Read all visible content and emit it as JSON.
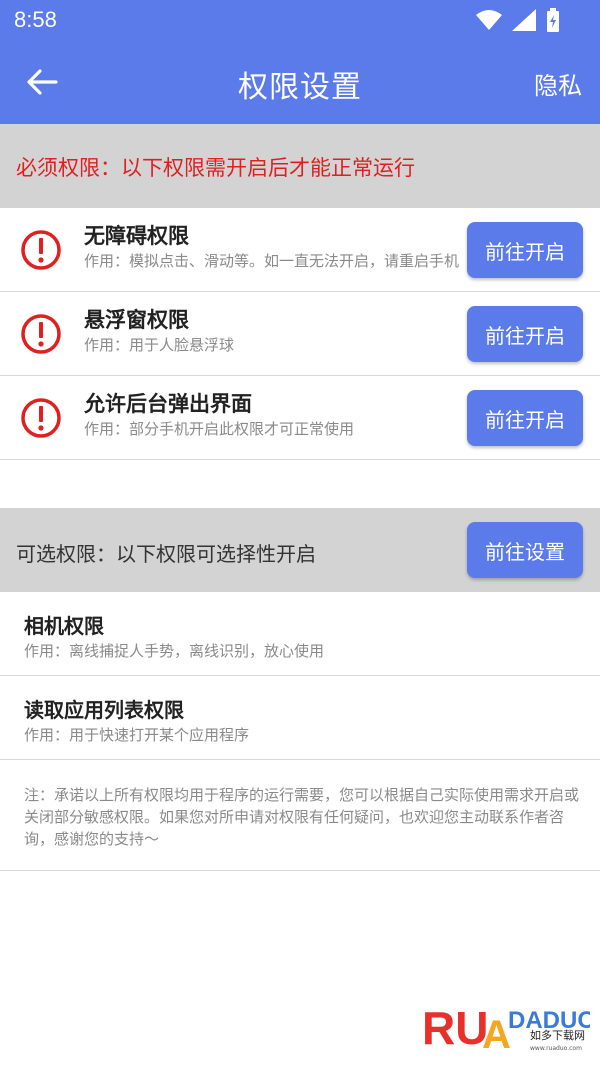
{
  "status_bar": {
    "time": "8:58"
  },
  "app_bar": {
    "title": "权限设置",
    "privacy_label": "隐私"
  },
  "required": {
    "header_text": "必须权限：以下权限需开启后才能正常运行",
    "items": [
      {
        "title": "无障碍权限",
        "desc": "作用：模拟点击、滑动等。如一直无法开启，请重启手机",
        "button": "前往开启"
      },
      {
        "title": "悬浮窗权限",
        "desc": "作用：用于人脸悬浮球",
        "button": "前往开启"
      },
      {
        "title": "允许后台弹出界面",
        "desc": "作用：部分手机开启此权限才可正常使用",
        "button": "前往开启"
      }
    ]
  },
  "optional": {
    "header_text": "可选权限：以下权限可选择性开启",
    "button": "前往设置",
    "items": [
      {
        "title": "相机权限",
        "desc": "作用：离线捕捉人手势，离线识别，放心使用"
      },
      {
        "title": "读取应用列表权限",
        "desc": "作用：用于快速打开某个应用程序"
      }
    ]
  },
  "note": "注：承诺以上所有权限均用于程序的运行需要，您可以根据自己实际使用需求开启或关闭部分敏感权限。如果您对所申请对权限有任何疑问，也欢迎您主动联系作者咨询，感谢您的支持～",
  "watermark": {
    "brand": "RUANDADUO",
    "subtitle": "如多下载网",
    "url": "www.ruaduo.com"
  },
  "colors": {
    "primary": "#5a7be9",
    "warning": "#e01f1f",
    "section_bg": "#d3d3d3"
  },
  "icons": {
    "back": "arrow-left-icon",
    "warning": "exclamation-circle-icon",
    "wifi": "wifi-icon",
    "signal": "signal-icon",
    "battery": "battery-icon"
  }
}
